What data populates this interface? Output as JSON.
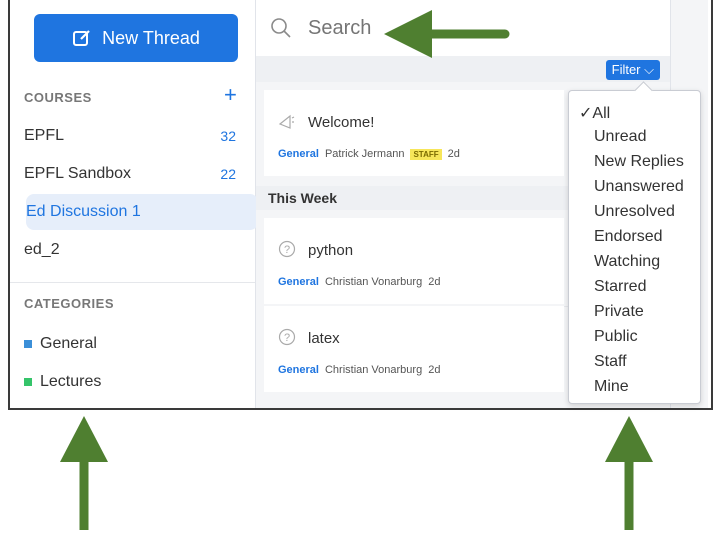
{
  "sidebar": {
    "new_thread_label": "New Thread",
    "courses_heading": "COURSES",
    "courses": [
      {
        "label": "EPFL",
        "count": "32"
      },
      {
        "label": "EPFL Sandbox",
        "count": "22"
      },
      {
        "label": "Ed Discussion 1",
        "count": ""
      },
      {
        "label": "ed_2",
        "count": ""
      }
    ],
    "categories_heading": "CATEGORIES",
    "categories": [
      {
        "label": "General",
        "color": "#3b8fd8"
      },
      {
        "label": "Lectures",
        "color": "#35c46a"
      }
    ]
  },
  "search": {
    "placeholder": "Search"
  },
  "filter": {
    "button_label": "Filter",
    "options": [
      "All",
      "Unread",
      "New Replies",
      "Unanswered",
      "Unresolved",
      "Endorsed",
      "Watching",
      "Starred",
      "Private",
      "Public",
      "Staff",
      "Mine"
    ],
    "selected_mark": "✓"
  },
  "threads": {
    "pinned": {
      "title": "Welcome!",
      "category": "General",
      "author": "Patrick Jermann",
      "badge": "STAFF",
      "age": "2d"
    },
    "section_label": "This Week",
    "items": [
      {
        "title": "python",
        "category": "General",
        "author": "Christian Vonarburg",
        "age": "2d"
      },
      {
        "title": "latex",
        "category": "General",
        "author": "Christian Vonarburg",
        "age": "2d"
      }
    ]
  },
  "colors": {
    "accent": "#1f75e0",
    "arrow": "#4f7f30"
  }
}
